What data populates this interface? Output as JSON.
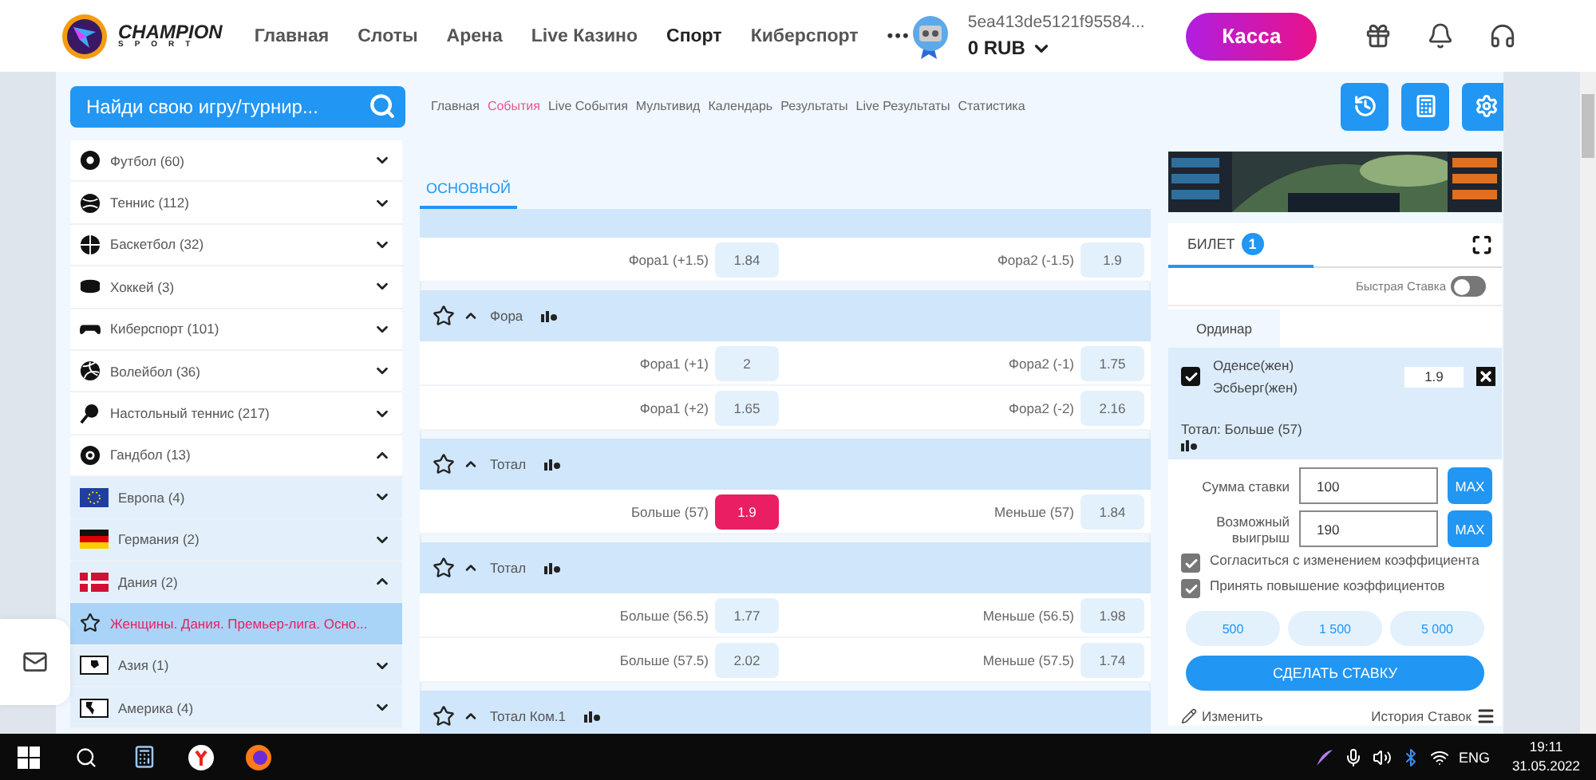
{
  "header": {
    "brand": "CHAMPION",
    "brand_sub": "SPORT",
    "more": "•••",
    "cashier": "Касса",
    "nav": [
      {
        "label": "Главная",
        "selected": false
      },
      {
        "label": "Слоты",
        "selected": false
      },
      {
        "label": "Арена",
        "selected": false
      },
      {
        "label": "Live Казино",
        "selected": false
      },
      {
        "label": "Спорт",
        "selected": true
      },
      {
        "label": "Киберспорт",
        "selected": false
      }
    ],
    "account": {
      "id": "5ea413de5121f95584...",
      "balance": "0 RUB"
    }
  },
  "subbar": {
    "search": {
      "placeholder": "Найди свою игру/турнир..."
    },
    "links": [
      {
        "label": "Главная",
        "selected": false
      },
      {
        "label": "События",
        "selected": true
      },
      {
        "label": "Live События",
        "selected": false
      },
      {
        "label": "Мультивид",
        "selected": false
      },
      {
        "label": "Календарь",
        "selected": false
      },
      {
        "label": "Результаты",
        "selected": false
      },
      {
        "label": "Live Результаты",
        "selected": false
      },
      {
        "label": "Статистика",
        "selected": false
      }
    ]
  },
  "sidebar": {
    "sports": [
      {
        "label": "Футбол (60)",
        "expanded": false,
        "selected": false
      },
      {
        "label": "Теннис (112)",
        "expanded": false,
        "selected": false
      },
      {
        "label": "Баскетбол (32)",
        "expanded": false,
        "selected": false
      },
      {
        "label": "Хоккей (3)",
        "expanded": false,
        "selected": false
      },
      {
        "label": "Киберспорт (101)",
        "expanded": false,
        "selected": false
      },
      {
        "label": "Волейбол (36)",
        "expanded": false,
        "selected": false
      },
      {
        "label": "Настольный теннис (217)",
        "expanded": false,
        "selected": false
      },
      {
        "label": "Гандбол (13)",
        "expanded": true,
        "selected": false,
        "children": [
          {
            "label": "Европа (4)",
            "expanded": false,
            "selected": false
          },
          {
            "label": "Германия (2)",
            "expanded": false,
            "selected": false
          },
          {
            "label": "Дания (2)",
            "expanded": true,
            "selected": false,
            "children": [
              {
                "label": "Женщины. Дания. Премьер-лига. Осно...",
                "selected": true
              }
            ]
          },
          {
            "label": "Азия (1)",
            "expanded": false,
            "selected": false
          },
          {
            "label": "Америка (4)",
            "expanded": false,
            "selected": false
          }
        ]
      }
    ]
  },
  "center": {
    "tabs": [
      {
        "label": "ОСНОВНОЙ",
        "selected": true
      }
    ],
    "markets": [
      {
        "rows": [
          {
            "left": {
              "label": "Фора1 (+1.5)",
              "odd": "1.84",
              "selected": false
            },
            "right": {
              "label": "Фора2 (-1.5)",
              "odd": "1.9",
              "selected": false
            }
          }
        ]
      },
      {
        "title": "Фора",
        "rows": [
          {
            "left": {
              "label": "Фора1 (+1)",
              "odd": "2",
              "selected": false
            },
            "right": {
              "label": "Фора2 (-1)",
              "odd": "1.75",
              "selected": false
            }
          },
          {
            "left": {
              "label": "Фора1 (+2)",
              "odd": "1.65",
              "selected": false
            },
            "right": {
              "label": "Фора2 (-2)",
              "odd": "2.16",
              "selected": false
            }
          }
        ]
      },
      {
        "title": "Тотал",
        "rows": [
          {
            "left": {
              "label": "Больше (57)",
              "odd": "1.9",
              "selected": true
            },
            "right": {
              "label": "Меньше (57)",
              "odd": "1.84",
              "selected": false
            }
          }
        ]
      },
      {
        "title": "Тотал",
        "rows": [
          {
            "left": {
              "label": "Больше (56.5)",
              "odd": "1.77",
              "selected": false
            },
            "right": {
              "label": "Меньше (56.5)",
              "odd": "1.98",
              "selected": false
            }
          },
          {
            "left": {
              "label": "Больше (57.5)",
              "odd": "2.02",
              "selected": false
            },
            "right": {
              "label": "Меньше (57.5)",
              "odd": "1.74",
              "selected": false
            }
          }
        ]
      },
      {
        "title": "Тотал Ком.1"
      }
    ]
  },
  "betslip": {
    "tab": "БИЛЕТ",
    "count": "1",
    "quick_bet": {
      "label": "Быстрая Ставка",
      "on": false
    },
    "type_tab": "Ординар",
    "bet": {
      "checked": true,
      "team1": "Оденсе(жен)",
      "team2": "Эсбьерг(жен)",
      "odd": "1.9",
      "market": "Тотал: Больше (57)"
    },
    "stake": {
      "label": "Сумма ставки",
      "value": "100",
      "max": "MAX"
    },
    "win": {
      "label": "Возможный выигрыш",
      "value": "190",
      "max": "MAX"
    },
    "options": [
      {
        "label": "Согласиться с изменением коэффициента",
        "checked": true
      },
      {
        "label": "Принять повышение коэффициентов",
        "checked": true
      }
    ],
    "amounts": [
      "500",
      "1 500",
      "5 000"
    ],
    "submit": "СДЕЛАТЬ СТАВКУ",
    "edit": "Изменить",
    "history": "История Ставок"
  },
  "taskbar": {
    "lang": "ENG",
    "time": "19:11",
    "date": "31.05.2022"
  }
}
